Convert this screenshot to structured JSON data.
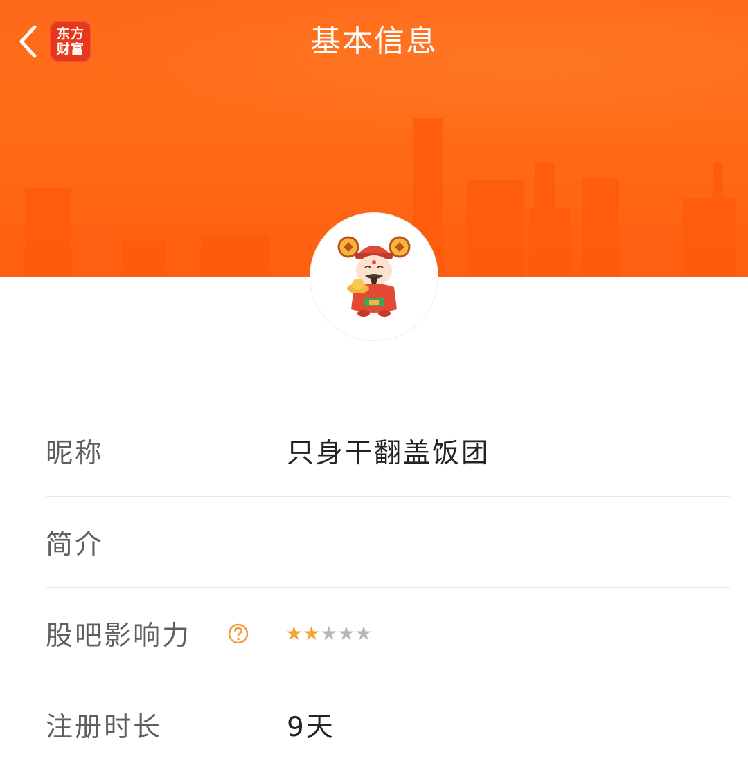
{
  "header": {
    "title": "基本信息",
    "brand_line1": "东方",
    "brand_line2": "财富",
    "back_icon": "chevron-left-icon"
  },
  "profile": {
    "avatar": "caishen-avatar"
  },
  "rows": {
    "nickname": {
      "label": "昵称",
      "value": "只身干翻盖饭团"
    },
    "bio": {
      "label": "简介",
      "value": ""
    },
    "influence": {
      "label": "股吧影响力",
      "stars_filled": 2,
      "stars_total": 5
    },
    "registration": {
      "label": "注册时长",
      "value": "9天"
    }
  },
  "colors": {
    "banner": "#ff6a1a",
    "star_filled": "#f7a23a",
    "star_empty": "#b8b8b8",
    "help_icon": "#f29b38"
  }
}
